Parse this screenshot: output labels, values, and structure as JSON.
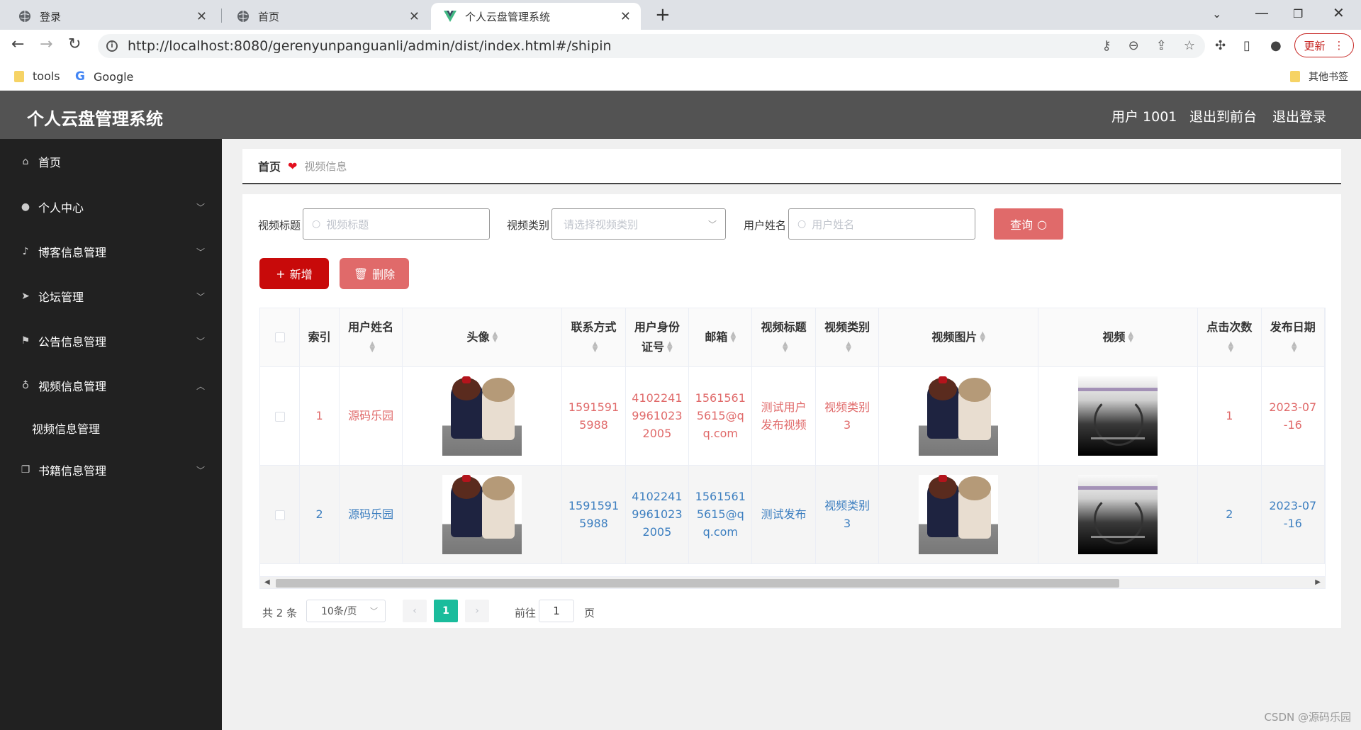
{
  "browser": {
    "tabs": [
      {
        "title": "登录"
      },
      {
        "title": "首页"
      },
      {
        "title": "个人云盘管理系统"
      }
    ],
    "url": "http://localhost:8080/gerenyunpanguanli/admin/dist/index.html#/shipin",
    "update_label": "更新",
    "bookmarks": {
      "tools": "tools",
      "google": "Google",
      "other": "其他书签"
    }
  },
  "header": {
    "title": "个人云盘管理系统",
    "user": "用户 1001",
    "to_front": "退出到前台",
    "logout": "退出登录"
  },
  "sidebar": {
    "items": [
      {
        "label": "首页"
      },
      {
        "label": "个人中心"
      },
      {
        "label": "博客信息管理"
      },
      {
        "label": "论坛管理"
      },
      {
        "label": "公告信息管理"
      },
      {
        "label": "视频信息管理"
      },
      {
        "label": "书籍信息管理"
      }
    ],
    "sub_item": "视频信息管理"
  },
  "breadcrumb": {
    "home": "首页",
    "current": "视频信息"
  },
  "filters": {
    "title_label": "视频标题",
    "title_placeholder": "视频标题",
    "type_label": "视频类别",
    "type_placeholder": "请选择视频类别",
    "user_label": "用户姓名",
    "user_placeholder": "用户姓名",
    "query_label": "查询"
  },
  "actions": {
    "add": "新增",
    "delete": "删除"
  },
  "table": {
    "columns": [
      "索引",
      "用户姓名",
      "头像",
      "联系方式",
      "用户身份证号",
      "邮箱",
      "视频标题",
      "视频类别",
      "视频图片",
      "视频",
      "点击次数",
      "发布日期"
    ],
    "rows": [
      {
        "index": "1",
        "username": "源码乐园",
        "phone": "15915915988",
        "idcard": "410224199610232005",
        "email": "15615615615@qq.com",
        "title": "测试用户发布视频",
        "type": "视频类别3",
        "clicks": "1",
        "date": "2023-07-16"
      },
      {
        "index": "2",
        "username": "源码乐园",
        "phone": "15915915988",
        "idcard": "410224199610232005",
        "email": "15615615615@qq.com",
        "title": "测试发布",
        "type": "视频类别3",
        "clicks": "2",
        "date": "2023-07-16"
      }
    ]
  },
  "pagination": {
    "total": "共 2 条",
    "page_size": "10条/页",
    "current": "1",
    "goto": "前往",
    "goto_value": "1",
    "unit": "页"
  },
  "watermark": "CSDN @源码乐园",
  "colors": {
    "header": "#535353",
    "sidebar": "#212121",
    "primary_red": "#c80a0a",
    "soft_red": "#e06a6a",
    "pager_active": "#1abc9c"
  }
}
